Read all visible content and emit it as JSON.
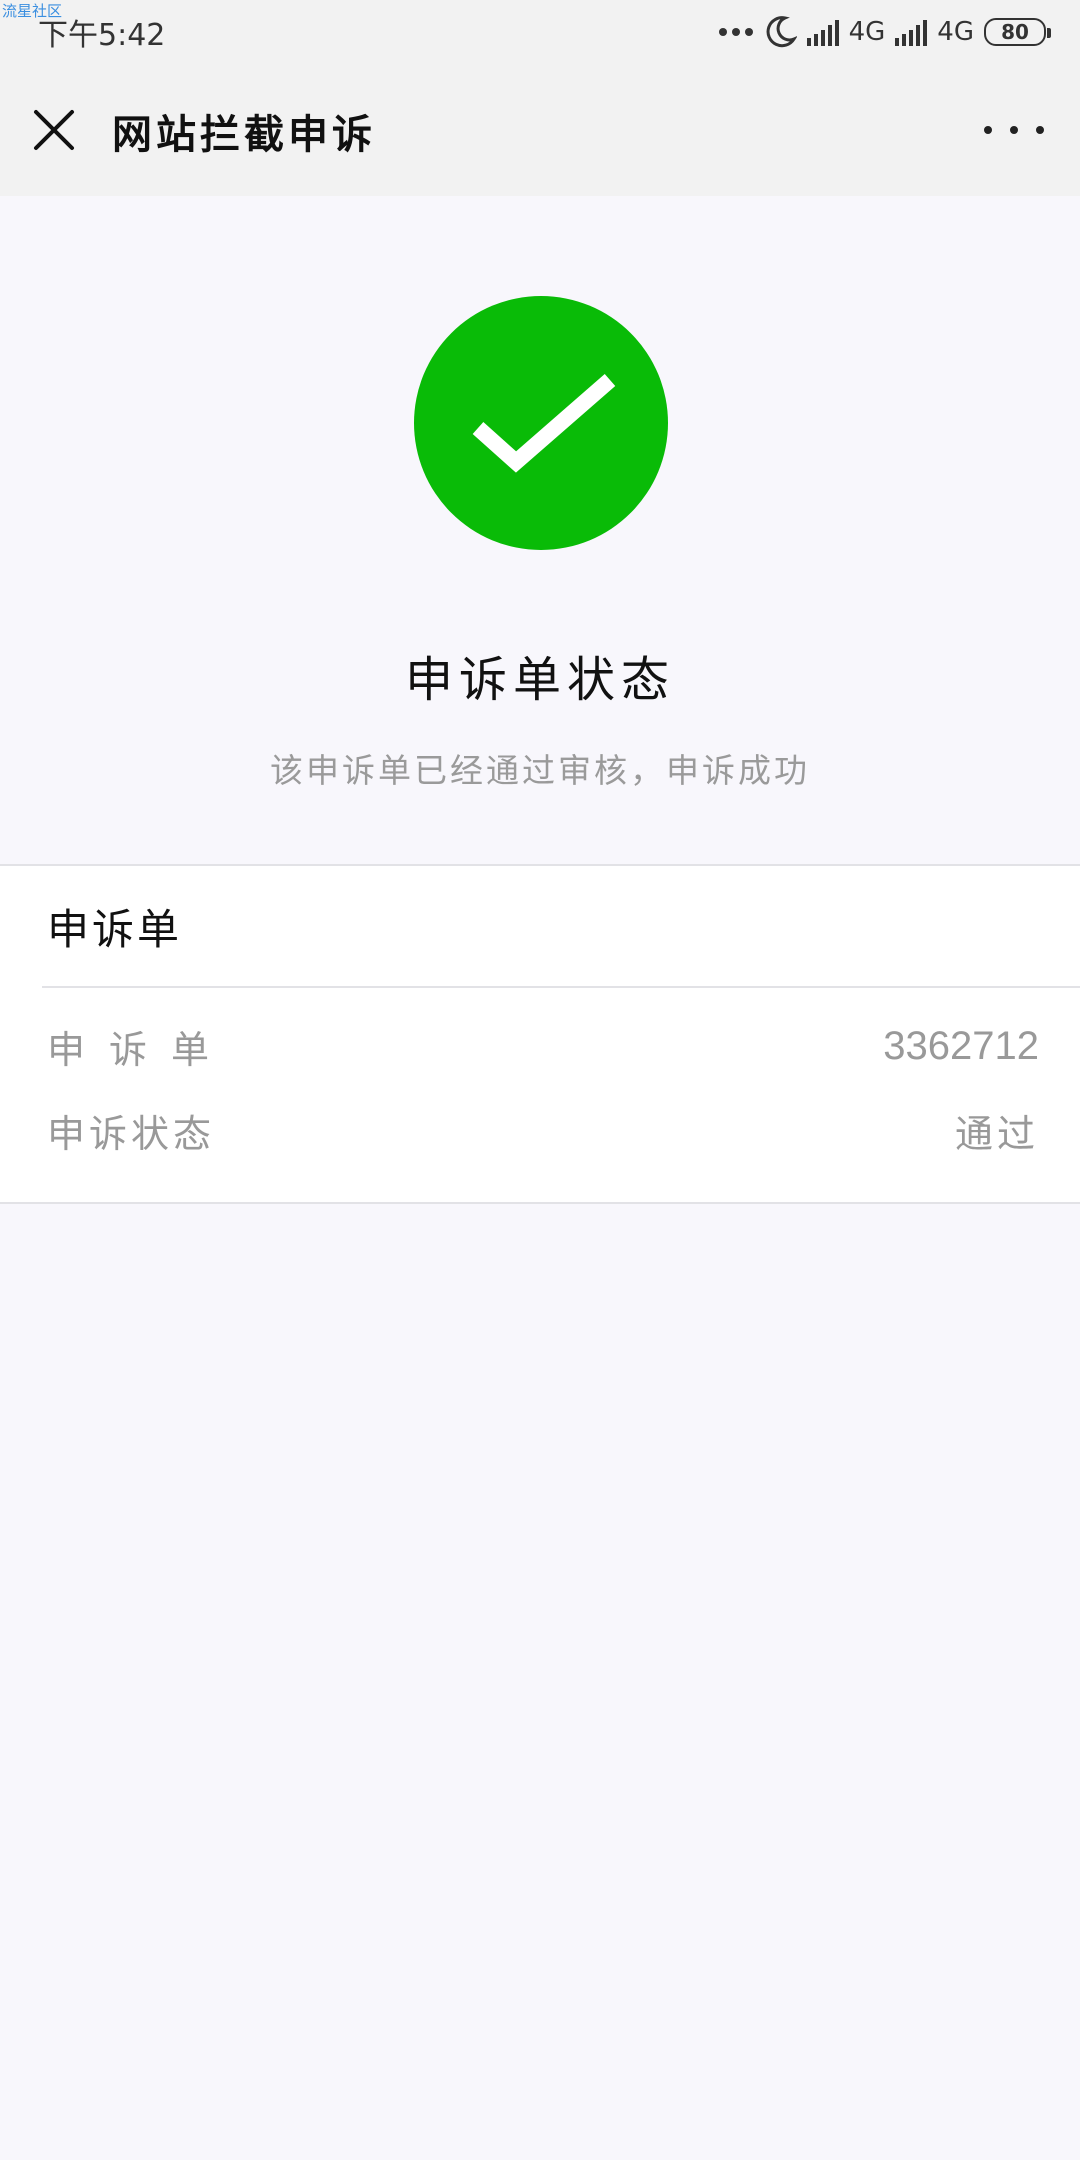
{
  "status_bar": {
    "watermark": "流星社区",
    "time": "下午5:42",
    "network_1": "4G",
    "network_2": "4G",
    "battery": "80"
  },
  "nav": {
    "title": "网站拦截申诉"
  },
  "status": {
    "title": "申诉单状态",
    "description": "该申诉单已经通过审核，申诉成功",
    "success_color": "#09bb07"
  },
  "card": {
    "title": "申诉单",
    "rows": [
      {
        "label": "申诉单",
        "value": "3362712"
      },
      {
        "label": "申诉状态",
        "value": "通过"
      }
    ]
  }
}
